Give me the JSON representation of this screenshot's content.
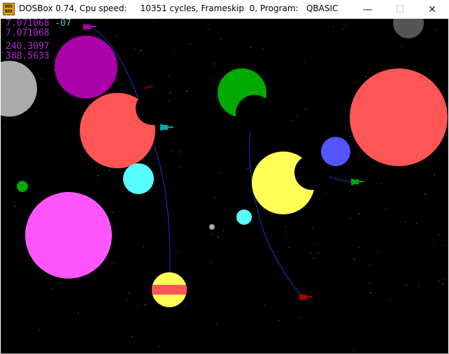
{
  "window": {
    "title": "DOSBox 0.74, Cpu speed:     10351 cycles, Frameskip  0, Program:   QBASIC",
    "icon_text_top": "DOS",
    "icon_text_bottom": "BOX",
    "minimize_glyph": "—",
    "maximize_glyph": "☐",
    "close_glyph": "✕"
  },
  "readouts": {
    "line1_value": "7.071068",
    "line1_exponent": "-07",
    "line2_value": "7.071068",
    "line3_value": "240.3097",
    "line4_value": "388.5633"
  },
  "colors": {
    "space": "#000000",
    "readout_magenta": "#b02cd0",
    "readout_cyan": "#4cb8c8",
    "trajectory": "#1a2a9a"
  },
  "planets": [
    {
      "name": "gray-planet-left",
      "color": "#aaaaaa"
    },
    {
      "name": "purple-planet",
      "color": "#aa00aa"
    },
    {
      "name": "salmon-planet-left",
      "color": "#ff5555"
    },
    {
      "name": "cyan-planet",
      "color": "#55ffff"
    },
    {
      "name": "small-green-planet",
      "color": "#00aa00"
    },
    {
      "name": "magenta-planet",
      "color": "#ff55ff"
    },
    {
      "name": "striped-yellow-planet",
      "color": "#ffff55"
    },
    {
      "name": "green-planet",
      "color": "#00aa00"
    },
    {
      "name": "yellow-planet",
      "color": "#ffff55"
    },
    {
      "name": "small-cyan-planet",
      "color": "#55ffff"
    },
    {
      "name": "blue-planet",
      "color": "#5555ff"
    },
    {
      "name": "salmon-planet-right",
      "color": "#ff5555"
    },
    {
      "name": "dark-gray-planet",
      "color": "#555555"
    },
    {
      "name": "tiny-gray-moon",
      "color": "#aaaaaa"
    }
  ],
  "ships": [
    {
      "name": "magenta-ship",
      "color": "#aa00aa"
    },
    {
      "name": "cyan-ship",
      "color": "#00aaaa"
    },
    {
      "name": "green-ship",
      "color": "#00aa00"
    },
    {
      "name": "red-ship",
      "color": "#aa0000"
    }
  ]
}
